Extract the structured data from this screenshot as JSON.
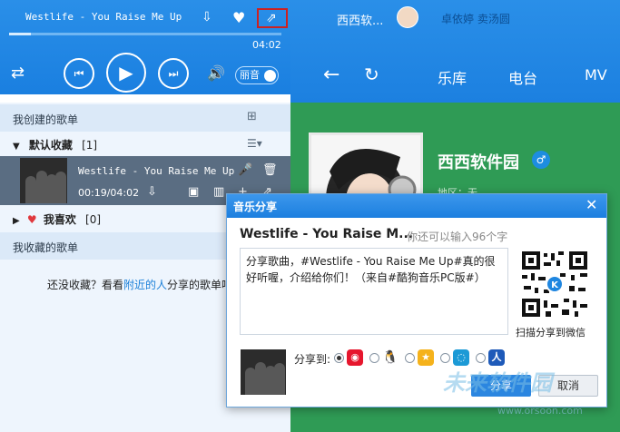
{
  "player": {
    "song_title": "Westlife - You Raise Me Up",
    "time_total": "04:02",
    "progress": 0.08,
    "sound_effect": "丽音"
  },
  "header": {
    "user_name": "西西软...",
    "user2": "卓依婷 卖汤圆",
    "nav": [
      "乐库",
      "电台",
      "MV"
    ]
  },
  "playlist": {
    "my_created": "我创建的歌单",
    "default_fav_label": "默认收藏",
    "default_fav_count": "[1]",
    "song": {
      "title": "Westlife - You Raise Me Up",
      "time": "00:19/04:02"
    },
    "love_label": "我喜欢",
    "love_count": "[0]",
    "my_collected": "我收藏的歌单",
    "empty_hint_pre": "还没收藏？看看",
    "empty_hint_link": "附近的人",
    "empty_hint_post": "分享的歌单吧"
  },
  "profile": {
    "name": "西西软件园",
    "gender": "♂",
    "region": "地区：无"
  },
  "dialog": {
    "title": "音乐分享",
    "song": "Westlife - You Raise M...",
    "remaining": "你还可以输入96个字",
    "text": "分享歌曲，#Westlife - You Raise Me Up#真的很好听喔，介绍给你们！（来自#酷狗音乐PC版#）",
    "qr_label": "扫描分享到微信",
    "share_to": "分享到:",
    "share_button": "分享",
    "cancel_button": "取消"
  },
  "watermark": {
    "text": "未来软件园",
    "url": "www.orsoon.com"
  },
  "colors": {
    "accent": "#1a7fe0",
    "profile_bg": "#2f9b55"
  }
}
